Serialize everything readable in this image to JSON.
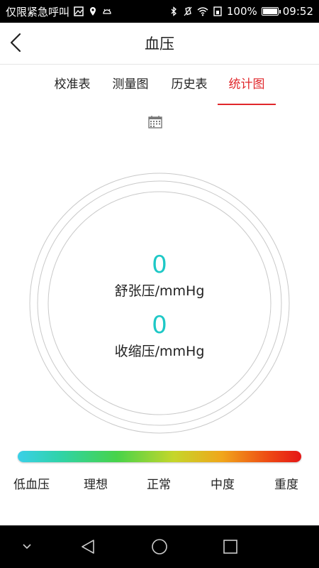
{
  "status_bar": {
    "left_text": "仅限紧急呼叫",
    "battery": "100%",
    "time": "09:52"
  },
  "header": {
    "title": "血压"
  },
  "tabs": [
    {
      "label": "校准表",
      "active": false
    },
    {
      "label": "测量图",
      "active": false
    },
    {
      "label": "历史表",
      "active": false
    },
    {
      "label": "统计图",
      "active": true
    }
  ],
  "gauge": {
    "diastolic_value": "0",
    "diastolic_unit": "舒张压/mmHg",
    "systolic_value": "0",
    "systolic_unit": "收缩压/mmHg"
  },
  "scale": {
    "levels": [
      "低血压",
      "理想",
      "正常",
      "中度",
      "重度"
    ]
  },
  "colors": {
    "accent_red": "#e0272b",
    "value_cyan": "#1ec8c6"
  },
  "icons": [
    "back-arrow-icon",
    "calendar-icon",
    "nav-back-icon",
    "nav-home-icon",
    "nav-recents-icon"
  ]
}
